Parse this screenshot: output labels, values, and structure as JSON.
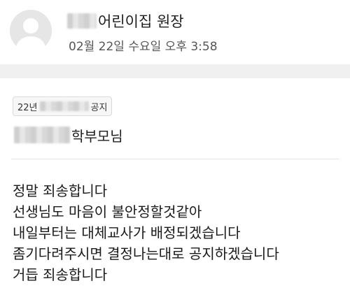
{
  "post": {
    "author_suffix": "어린이집 원장",
    "timestamp": "02월 22일 수요일 오후 3:58"
  },
  "notice": {
    "tag_prefix": "22년",
    "tag_suffix": "공지",
    "recipient_suffix": "학부모님",
    "lines": [
      "정말 죄송합니다",
      "선생님도 마음이 불안정할것같아",
      "내일부터는 대체교사가 배정되겠습니다",
      "좀기다려주시면 결정나는대로 공지하겠습니다",
      "거듭 죄송합니다"
    ]
  },
  "icons": {
    "avatar": "default-user-icon"
  },
  "colors": {
    "avatar_bg": "#e6e6e6",
    "band": "#f0f0f0"
  }
}
